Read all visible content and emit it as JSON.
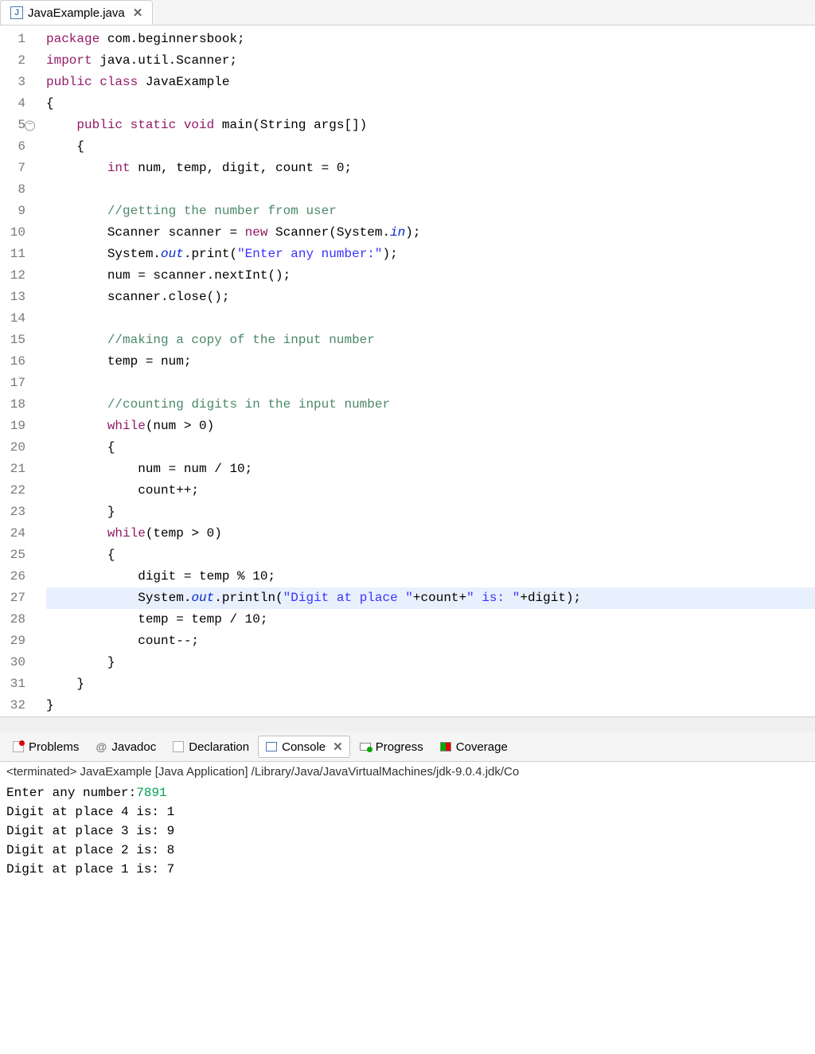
{
  "tab": {
    "filename": "JavaExample.java",
    "icon_letter": "J"
  },
  "gutter": {
    "line_count": 32,
    "marker_lines": [
      5,
      27,
      28,
      29,
      30,
      31
    ],
    "fold_line": 5
  },
  "code": {
    "lines": [
      {
        "n": 1,
        "tokens": [
          {
            "t": "package ",
            "c": "kw"
          },
          {
            "t": "com.beginnersbook;",
            "c": "default"
          }
        ]
      },
      {
        "n": 2,
        "tokens": [
          {
            "t": "import ",
            "c": "kw"
          },
          {
            "t": "java.util.Scanner;",
            "c": "default"
          }
        ]
      },
      {
        "n": 3,
        "tokens": [
          {
            "t": "public class ",
            "c": "kw"
          },
          {
            "t": "JavaExample",
            "c": "default"
          }
        ]
      },
      {
        "n": 4,
        "tokens": [
          {
            "t": "{",
            "c": "default"
          }
        ]
      },
      {
        "n": 5,
        "tokens": [
          {
            "t": "    ",
            "c": "default"
          },
          {
            "t": "public static ",
            "c": "kw"
          },
          {
            "t": "void ",
            "c": "kw"
          },
          {
            "t": "main(String args[])",
            "c": "default"
          }
        ]
      },
      {
        "n": 6,
        "tokens": [
          {
            "t": "    {",
            "c": "default"
          }
        ]
      },
      {
        "n": 7,
        "tokens": [
          {
            "t": "        ",
            "c": "default"
          },
          {
            "t": "int ",
            "c": "kw"
          },
          {
            "t": "num, temp, digit, count = 0;",
            "c": "default"
          }
        ]
      },
      {
        "n": 8,
        "tokens": []
      },
      {
        "n": 9,
        "tokens": [
          {
            "t": "        ",
            "c": "default"
          },
          {
            "t": "//getting the number from user",
            "c": "cmt"
          }
        ]
      },
      {
        "n": 10,
        "tokens": [
          {
            "t": "        Scanner scanner = ",
            "c": "default"
          },
          {
            "t": "new ",
            "c": "kw"
          },
          {
            "t": "Scanner(System.",
            "c": "default"
          },
          {
            "t": "in",
            "c": "fld"
          },
          {
            "t": ");",
            "c": "default"
          }
        ]
      },
      {
        "n": 11,
        "tokens": [
          {
            "t": "        System.",
            "c": "default"
          },
          {
            "t": "out",
            "c": "fld"
          },
          {
            "t": ".print(",
            "c": "default"
          },
          {
            "t": "\"Enter any number:\"",
            "c": "str"
          },
          {
            "t": ");",
            "c": "default"
          }
        ]
      },
      {
        "n": 12,
        "tokens": [
          {
            "t": "        num = scanner.nextInt();",
            "c": "default"
          }
        ]
      },
      {
        "n": 13,
        "tokens": [
          {
            "t": "        scanner.close();",
            "c": "default"
          }
        ]
      },
      {
        "n": 14,
        "tokens": []
      },
      {
        "n": 15,
        "tokens": [
          {
            "t": "        ",
            "c": "default"
          },
          {
            "t": "//making a copy of the input number",
            "c": "cmt"
          }
        ]
      },
      {
        "n": 16,
        "tokens": [
          {
            "t": "        temp = num;",
            "c": "default"
          }
        ]
      },
      {
        "n": 17,
        "tokens": []
      },
      {
        "n": 18,
        "tokens": [
          {
            "t": "        ",
            "c": "default"
          },
          {
            "t": "//counting digits in the input number",
            "c": "cmt"
          }
        ]
      },
      {
        "n": 19,
        "tokens": [
          {
            "t": "        ",
            "c": "default"
          },
          {
            "t": "while",
            "c": "kw"
          },
          {
            "t": "(num > 0)",
            "c": "default"
          }
        ]
      },
      {
        "n": 20,
        "tokens": [
          {
            "t": "        {",
            "c": "default"
          }
        ]
      },
      {
        "n": 21,
        "tokens": [
          {
            "t": "            num = num / 10;",
            "c": "default"
          }
        ]
      },
      {
        "n": 22,
        "tokens": [
          {
            "t": "            count++;",
            "c": "default"
          }
        ]
      },
      {
        "n": 23,
        "tokens": [
          {
            "t": "        }",
            "c": "default"
          }
        ]
      },
      {
        "n": 24,
        "tokens": [
          {
            "t": "        ",
            "c": "default"
          },
          {
            "t": "while",
            "c": "kw"
          },
          {
            "t": "(temp > 0)",
            "c": "default"
          }
        ]
      },
      {
        "n": 25,
        "tokens": [
          {
            "t": "        {",
            "c": "default"
          }
        ]
      },
      {
        "n": 26,
        "tokens": [
          {
            "t": "            digit = temp % 10;",
            "c": "default"
          }
        ]
      },
      {
        "n": 27,
        "hl": true,
        "tokens": [
          {
            "t": "            System.",
            "c": "default"
          },
          {
            "t": "out",
            "c": "fld"
          },
          {
            "t": ".println(",
            "c": "default"
          },
          {
            "t": "\"Digit at place \"",
            "c": "str"
          },
          {
            "t": "+count+",
            "c": "default"
          },
          {
            "t": "\" is: \"",
            "c": "str"
          },
          {
            "t": "+digit);",
            "c": "default"
          }
        ]
      },
      {
        "n": 28,
        "tokens": [
          {
            "t": "            temp = temp / 10;",
            "c": "default"
          }
        ]
      },
      {
        "n": 29,
        "tokens": [
          {
            "t": "            count--;",
            "c": "default"
          }
        ]
      },
      {
        "n": 30,
        "tokens": [
          {
            "t": "        }",
            "c": "default"
          }
        ]
      },
      {
        "n": 31,
        "tokens": [
          {
            "t": "    }",
            "c": "default"
          }
        ]
      },
      {
        "n": 32,
        "tokens": [
          {
            "t": "}",
            "c": "default"
          }
        ]
      }
    ]
  },
  "bottom_tabs": [
    {
      "label": "Problems",
      "icon": "problems"
    },
    {
      "label": "Javadoc",
      "icon": "javadoc"
    },
    {
      "label": "Declaration",
      "icon": "decl"
    },
    {
      "label": "Console",
      "icon": "console",
      "active": true,
      "closable": true
    },
    {
      "label": "Progress",
      "icon": "progress"
    },
    {
      "label": "Coverage",
      "icon": "coverage"
    }
  ],
  "console": {
    "status": "<terminated> JavaExample [Java Application] /Library/Java/JavaVirtualMachines/jdk-9.0.4.jdk/Co",
    "prompt": "Enter any number:",
    "input_value": "7891",
    "output_lines": [
      "Digit at place 4 is: 1",
      "Digit at place 3 is: 9",
      "Digit at place 2 is: 8",
      "Digit at place 1 is: 7"
    ]
  }
}
